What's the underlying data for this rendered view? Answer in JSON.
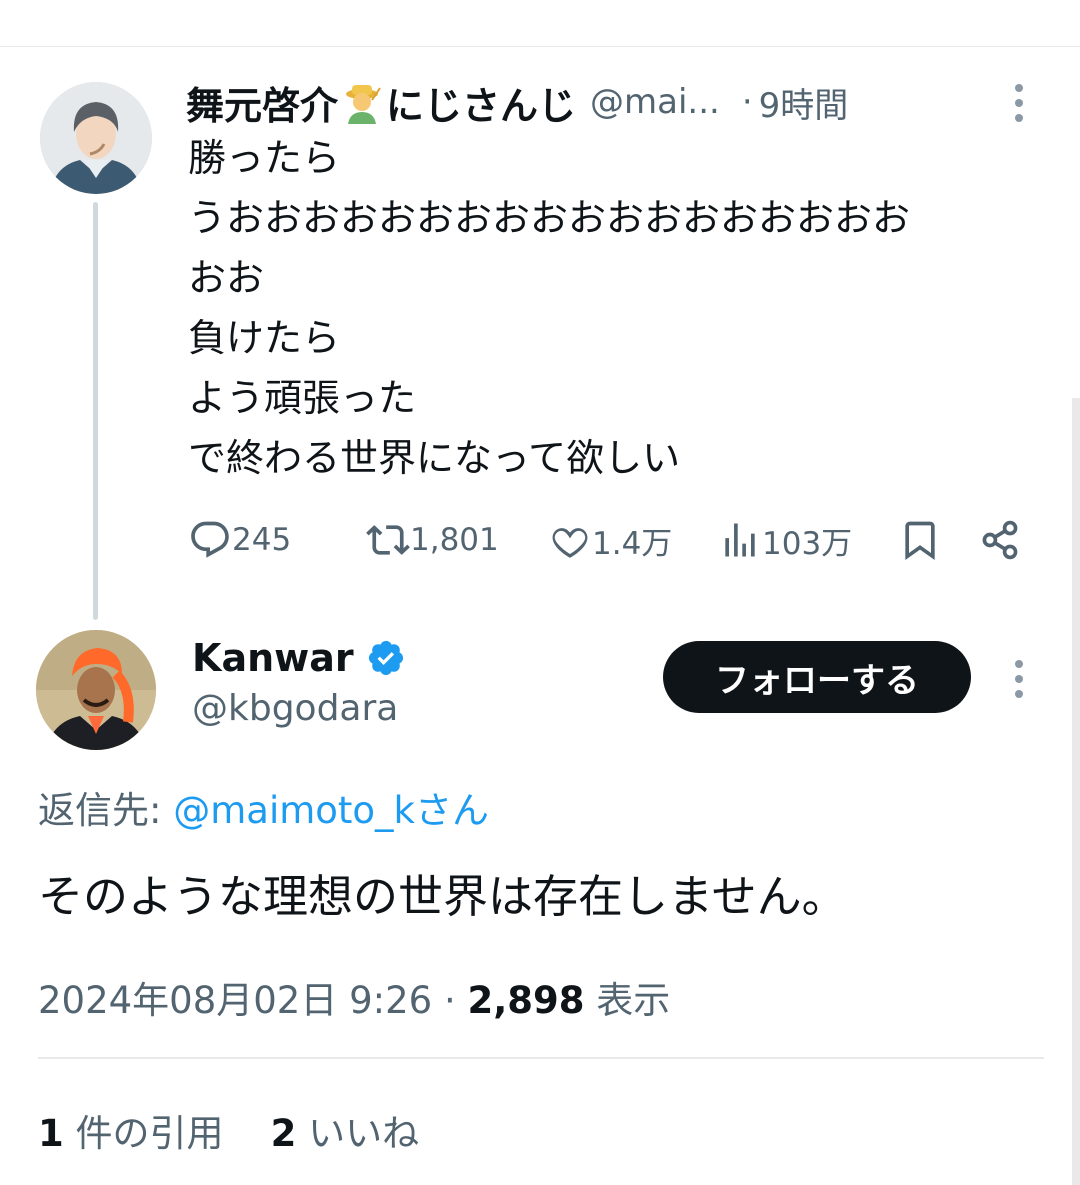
{
  "parent_tweet": {
    "display_name": "舞元啓介",
    "display_name_suffix": "にじさんじ",
    "handle": "@mai...",
    "separator": "·",
    "time": "9時間",
    "body_lines": [
      "勝ったら",
      "うおおおおおおおおおおおおおおおおおお",
      "おお",
      "負けたら",
      "よう頑張った",
      "で終わる世界になって欲しい"
    ],
    "replies": "245",
    "retweets": "1,801",
    "likes": "1.4万",
    "views": "103万",
    "icons": {
      "emoji": "farmer-emoji-icon",
      "reply": "reply-icon",
      "retweet": "retweet-icon",
      "like": "heart-icon",
      "views": "analytics-icon",
      "bookmark": "bookmark-icon",
      "share": "share-icon",
      "more": "more-icon"
    }
  },
  "reply_tweet": {
    "display_name": "Kanwar",
    "handle": "@kbgodara",
    "follow_label": "フォローする",
    "reply_to_prefix": "返信先:",
    "reply_to_mention": "@maimoto_kさん",
    "body": "そのような理想の世界は存在しません。",
    "timestamp": "2024年08月02日 9:26",
    "separator": "·",
    "views_count": "2,898",
    "views_label": "表示",
    "quote_count": "1",
    "quote_label": "件の引用",
    "like_count": "2",
    "like_label": "いいね",
    "icons": {
      "verified": "verified-badge-icon",
      "more": "more-icon"
    }
  },
  "colors": {
    "text": "#0f1419",
    "secondary": "#536471",
    "accent": "#1d9bf0",
    "thread_line": "#cfd9de",
    "divider": "#e7e9ea"
  }
}
